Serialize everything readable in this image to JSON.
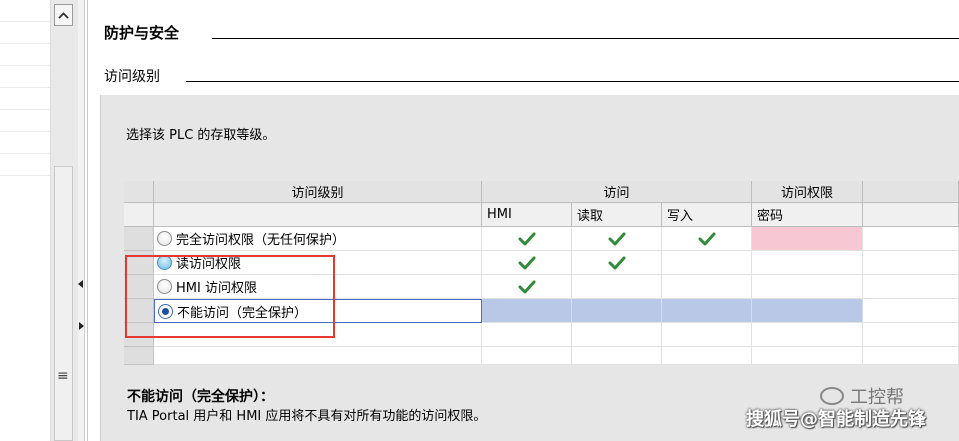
{
  "section": {
    "title": "防护与安全",
    "subtitle": "访问级别"
  },
  "prompt": "选择该 PLC 的存取等级。",
  "table": {
    "headers": {
      "level": "访问级别",
      "access": "访问",
      "permission": "访问权限"
    },
    "subheaders": {
      "hmi": "HMI",
      "read": "读取",
      "write": "写入",
      "password": "密码"
    },
    "rows": [
      {
        "label": "完全访问权限（无任何保护）",
        "hmi": true,
        "read": true,
        "write": true,
        "password_required": true,
        "radio": "unchecked"
      },
      {
        "label": "读访问权限",
        "hmi": true,
        "read": true,
        "write": false,
        "password_required": false,
        "radio": "hover"
      },
      {
        "label": "HMI 访问权限",
        "hmi": true,
        "read": false,
        "write": false,
        "password_required": false,
        "radio": "unchecked"
      },
      {
        "label": "不能访问（完全保护）",
        "hmi": false,
        "read": false,
        "write": false,
        "password_required": false,
        "radio": "checked"
      }
    ]
  },
  "description": {
    "title": "不能访问（完全保护）：",
    "text": "TIA Portal 用户和 HMI 应用将不具有对所有功能的访问权限。"
  },
  "watermark": {
    "brand": "工控帮",
    "credit": "搜狐号@智能制造先锋"
  },
  "colors": {
    "check": "#2f8a3a",
    "selection": "#b8c8e6",
    "password_cell": "#f7c8d4",
    "highlight_box": "#e53935"
  },
  "icons": {
    "check": "check-icon",
    "scroll_up": "chevron-up-icon",
    "menu": "menu-icon"
  }
}
